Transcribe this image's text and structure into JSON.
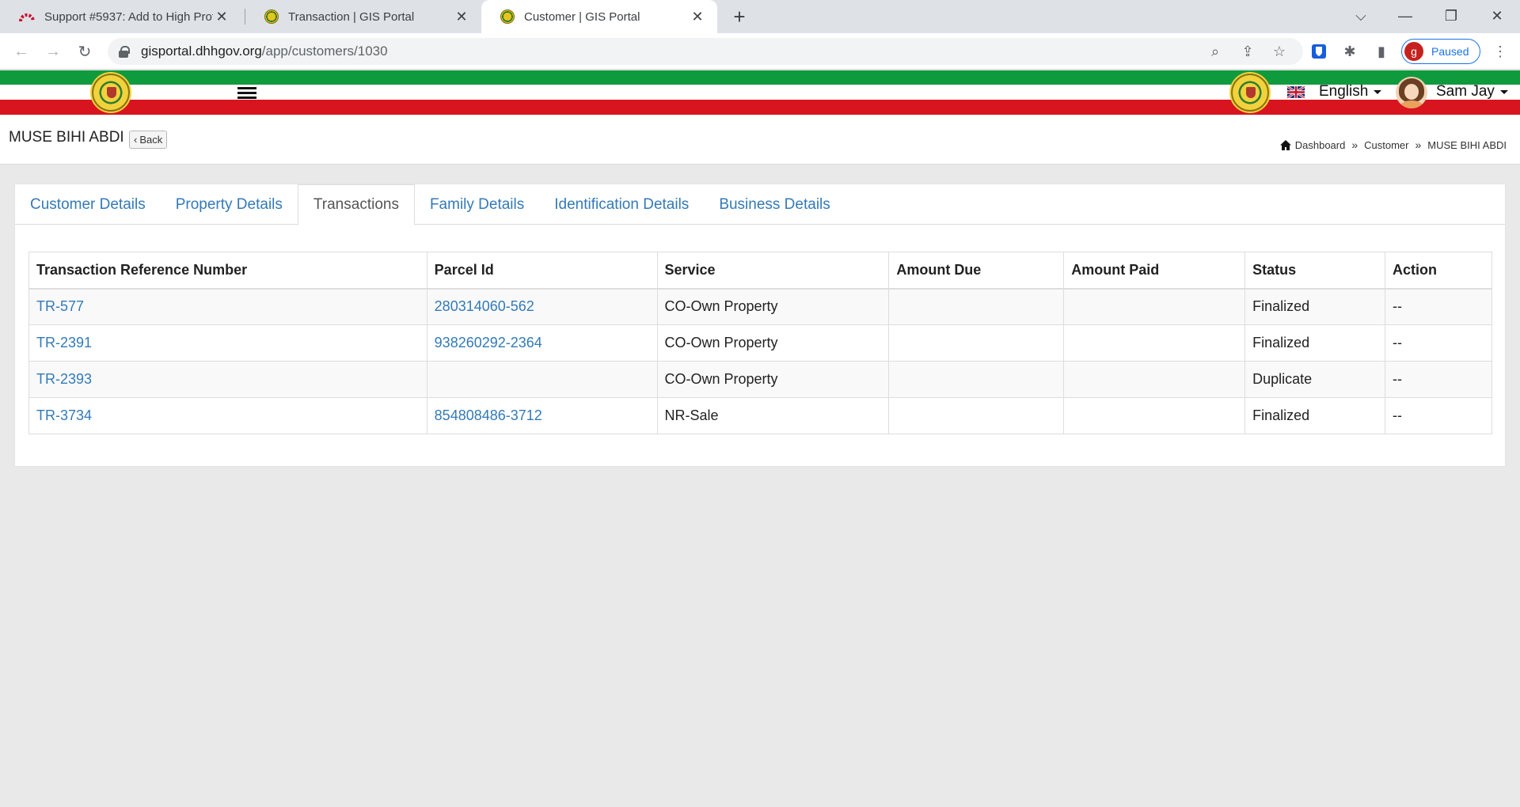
{
  "browser": {
    "tabs": [
      {
        "title": "Support #5937: Add to High Prof",
        "icon": "redmine-icon"
      },
      {
        "title": "Transaction | GIS Portal",
        "icon": "gis-seal-icon"
      },
      {
        "title": "Customer | GIS Portal",
        "icon": "gis-seal-icon",
        "active": true
      }
    ],
    "url_host": "gisportal.dhhgov.org",
    "url_path": "/app/customers/1030",
    "profile_initial": "g",
    "profile_status": "Paused"
  },
  "header": {
    "language": "English",
    "user_name": "Sam Jay"
  },
  "page": {
    "title": "MUSE BIHI ABDI",
    "back_label": "Back",
    "breadcrumb": [
      "Dashboard",
      "Customer",
      "MUSE BIHI ABDI"
    ]
  },
  "tabs": [
    "Customer Details",
    "Property Details",
    "Transactions",
    "Family Details",
    "Identification Details",
    "Business Details"
  ],
  "active_tab": "Transactions",
  "table": {
    "columns": [
      "Transaction Reference Number",
      "Parcel Id",
      "Service",
      "Amount Due",
      "Amount Paid",
      "Status",
      "Action"
    ],
    "rows": [
      {
        "ref": "TR-577",
        "parcel": "280314060-562",
        "service": "CO-Own Property",
        "due": "",
        "paid": "",
        "status": "Finalized",
        "action": "--"
      },
      {
        "ref": "TR-2391",
        "parcel": "938260292-2364",
        "service": "CO-Own Property",
        "due": "",
        "paid": "",
        "status": "Finalized",
        "action": "--"
      },
      {
        "ref": "TR-2393",
        "parcel": "",
        "service": "CO-Own Property",
        "due": "",
        "paid": "",
        "status": "Duplicate",
        "action": "--"
      },
      {
        "ref": "TR-3734",
        "parcel": "854808486-3712",
        "service": "NR-Sale",
        "due": "",
        "paid": "",
        "status": "Finalized",
        "action": "--"
      }
    ]
  },
  "colors": {
    "link": "#337ab7",
    "flag_green": "#109a3e",
    "flag_red": "#d8141f",
    "page_bg": "#e9e9e9"
  }
}
